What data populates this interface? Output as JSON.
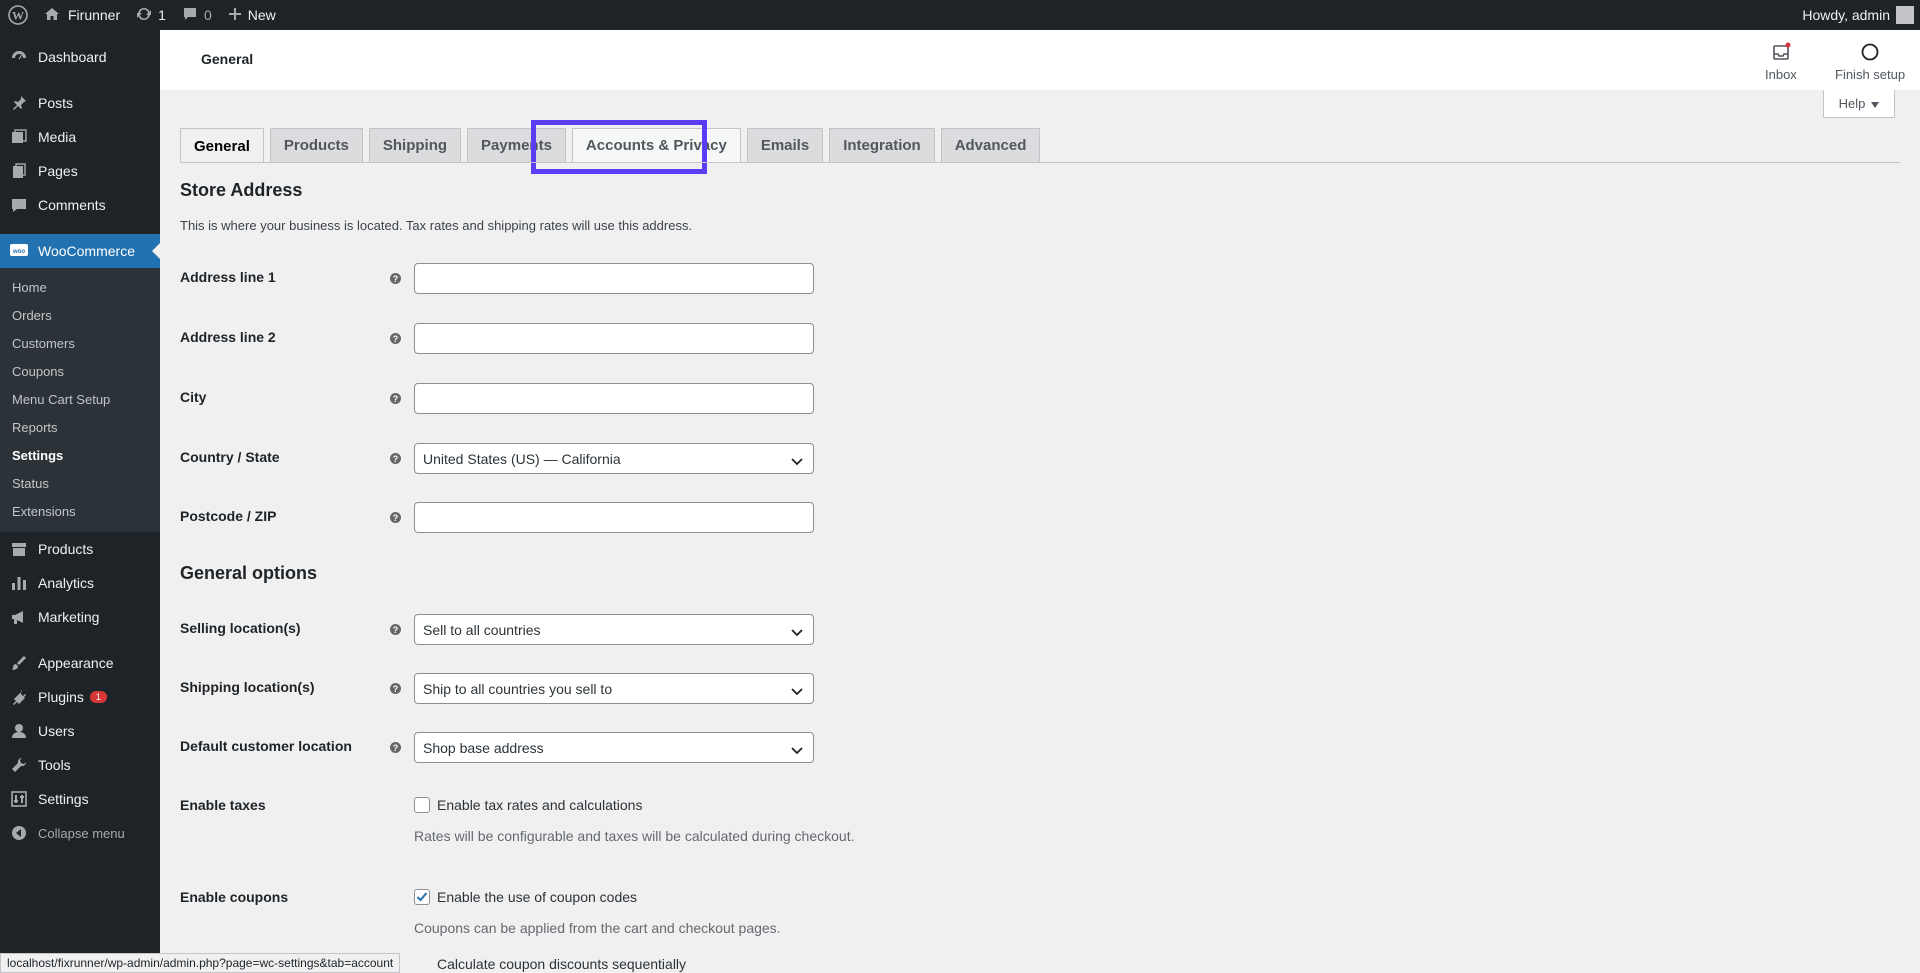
{
  "admin_bar": {
    "site_name": "Firunner",
    "updates_count": "1",
    "comments_count": "0",
    "new_label": "New",
    "howdy": "Howdy, admin"
  },
  "sidebar": {
    "dashboard": "Dashboard",
    "posts": "Posts",
    "media": "Media",
    "pages": "Pages",
    "comments": "Comments",
    "woocommerce": "WooCommerce",
    "woo_submenu": [
      "Home",
      "Orders",
      "Customers",
      "Coupons",
      "Menu Cart Setup",
      "Reports",
      "Settings",
      "Status",
      "Extensions"
    ],
    "products": "Products",
    "analytics": "Analytics",
    "marketing": "Marketing",
    "appearance": "Appearance",
    "plugins": "Plugins",
    "plugins_badge": "1",
    "users": "Users",
    "tools": "Tools",
    "settings": "Settings",
    "collapse": "Collapse menu"
  },
  "header": {
    "title": "General",
    "inbox": "Inbox",
    "finish_setup": "Finish setup",
    "help": "Help"
  },
  "tabs": [
    "General",
    "Products",
    "Shipping",
    "Payments",
    "Accounts & Privacy",
    "Emails",
    "Integration",
    "Advanced"
  ],
  "store_address": {
    "heading": "Store Address",
    "description": "This is where your business is located. Tax rates and shipping rates will use this address.",
    "address1_label": "Address line 1",
    "address2_label": "Address line 2",
    "city_label": "City",
    "country_label": "Country / State",
    "country_value": "United States (US) — California",
    "postcode_label": "Postcode / ZIP"
  },
  "general_options": {
    "heading": "General options",
    "selling_label": "Selling location(s)",
    "selling_value": "Sell to all countries",
    "shipping_label": "Shipping location(s)",
    "shipping_value": "Ship to all countries you sell to",
    "default_customer_label": "Default customer location",
    "default_customer_value": "Shop base address",
    "taxes_label": "Enable taxes",
    "taxes_checkbox": "Enable tax rates and calculations",
    "taxes_help": "Rates will be configurable and taxes will be calculated during checkout.",
    "coupons_label": "Enable coupons",
    "coupons_checkbox": "Enable the use of coupon codes",
    "coupons_help": "Coupons can be applied from the cart and checkout pages.",
    "sequential": "Calculate coupon discounts sequentially"
  },
  "status_url": "localhost/fixrunner/wp-admin/admin.php?page=wc-settings&tab=account"
}
